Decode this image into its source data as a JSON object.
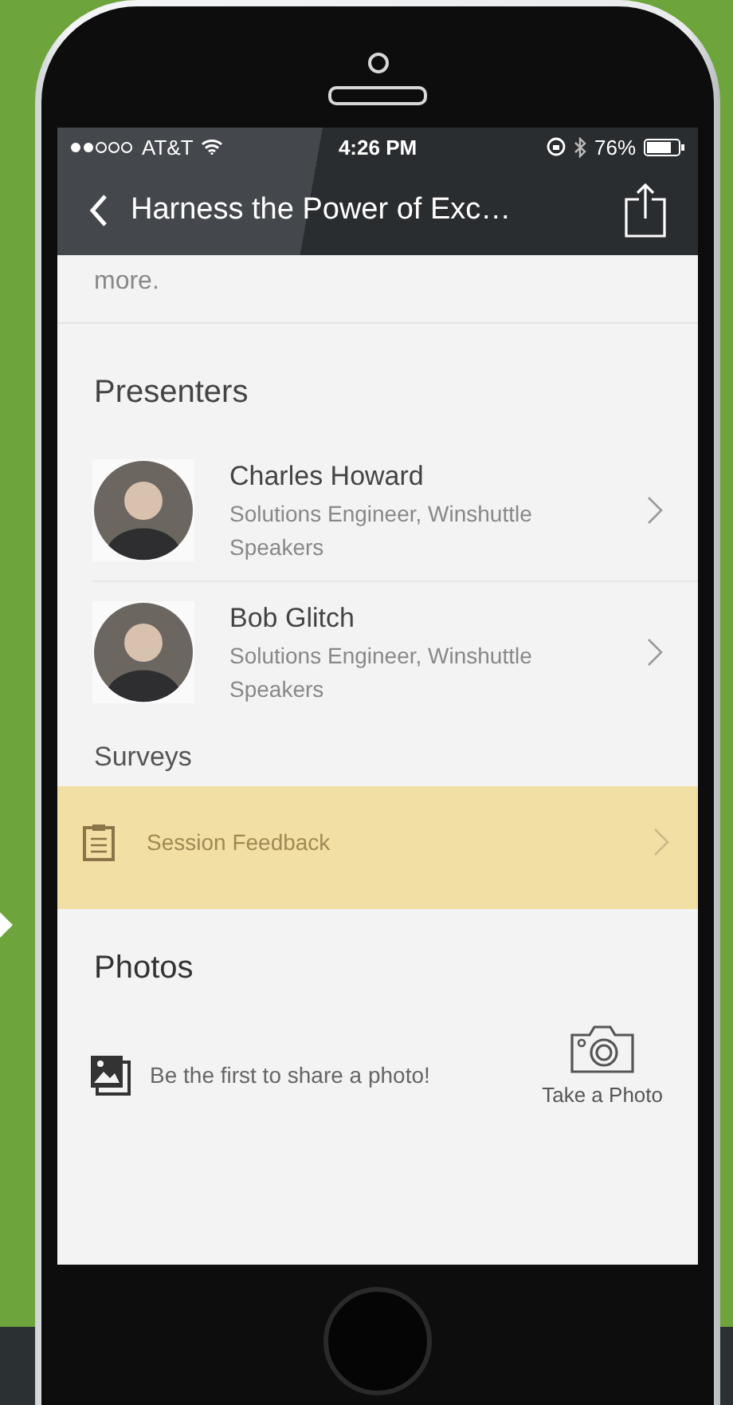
{
  "status_bar": {
    "carrier": "AT&T",
    "time": "4:26 PM",
    "battery": "76%"
  },
  "nav": {
    "title": "Harness the Power of Exc…"
  },
  "description_tail": "more.",
  "presenters": {
    "heading": "Presenters",
    "items": [
      {
        "name": "Charles Howard",
        "title": "Solutions Engineer, Winshuttle",
        "category": "Speakers"
      },
      {
        "name": "Bob Glitch",
        "title": "Solutions Engineer, Winshuttle",
        "category": "Speakers"
      }
    ]
  },
  "surveys": {
    "heading": "Surveys",
    "items": [
      {
        "label": "Session Feedback",
        "selected": true
      }
    ]
  },
  "photos": {
    "heading": "Photos",
    "empty_message": "Be the first to share a photo!",
    "action": "Take a Photo"
  }
}
